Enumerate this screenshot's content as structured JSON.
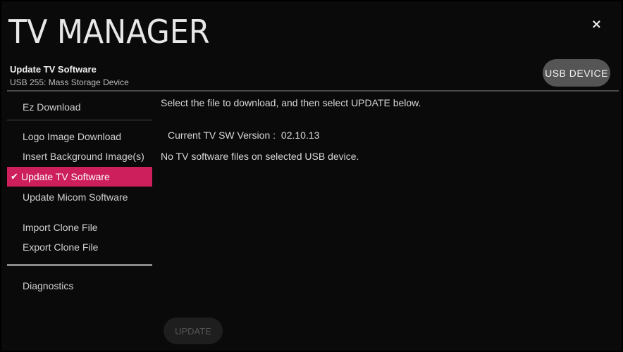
{
  "header": {
    "app_title": "TV MANAGER",
    "close_symbol": "×",
    "section_title": "Update TV Software",
    "device_label": "USB 255: Mass Storage Device",
    "usb_button_label": "USB DEVICE"
  },
  "sidebar": {
    "items": [
      {
        "label": "Ez Download",
        "selected": false
      },
      {
        "label": "Logo Image Download",
        "selected": false
      },
      {
        "label": "Insert Background Image(s)",
        "selected": false
      },
      {
        "label": "Update TV Software",
        "selected": true
      },
      {
        "label": "Update Micom Software",
        "selected": false
      },
      {
        "label": "Import Clone File",
        "selected": false
      },
      {
        "label": "Export Clone File",
        "selected": false
      },
      {
        "label": "Diagnostics",
        "selected": false
      }
    ],
    "check_symbol": "✔"
  },
  "main": {
    "instruction": "Select the file to download, and then select UPDATE below.",
    "version_label": "Current TV SW Version :",
    "version_value": "02.10.13",
    "status": "No TV software files on selected USB device.",
    "update_button_label": "UPDATE",
    "update_button_enabled": false
  },
  "colors": {
    "accent": "#cc1f5b",
    "background": "#0a0a0a"
  }
}
